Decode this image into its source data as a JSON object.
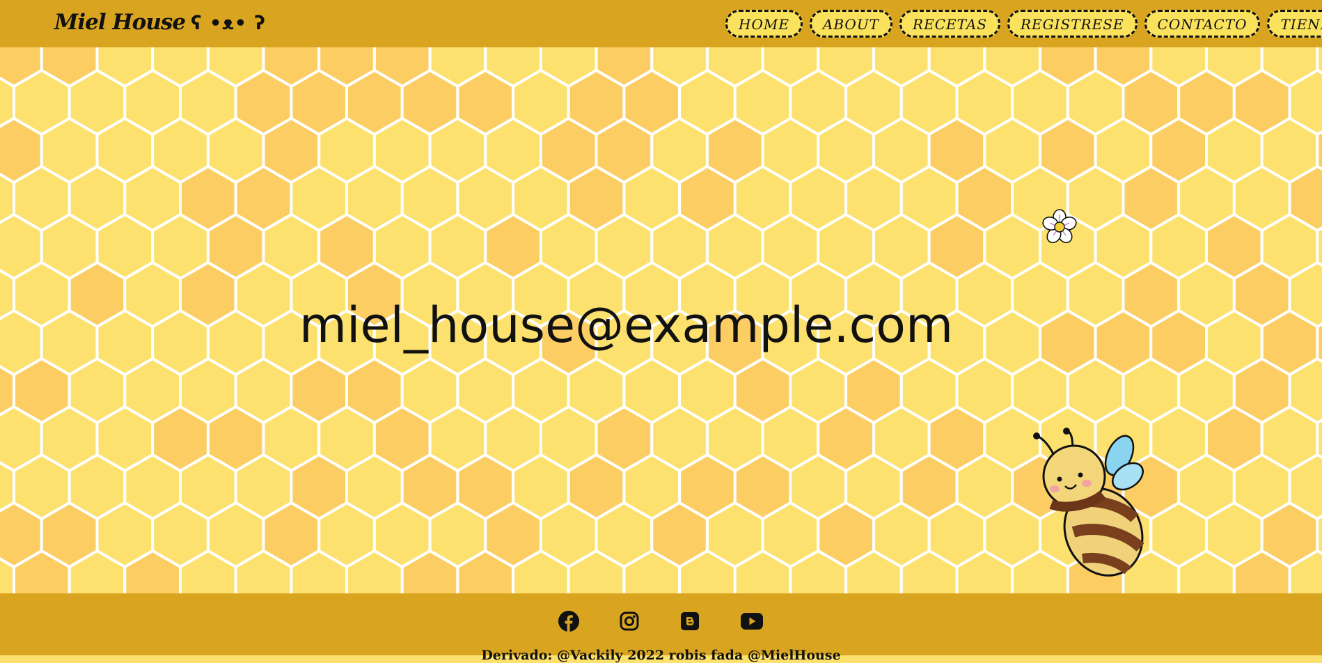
{
  "header": {
    "brand": "Miel House",
    "brand_face": "ʕ •ᴥ• ʔ",
    "nav": [
      "HOME",
      "ABOUT",
      "RECETAS",
      "REGISTRESE",
      "CONTACTO",
      "TIENDA"
    ]
  },
  "hero": {
    "email": "miel_house@example.com",
    "decor_icons": [
      "flower-icon",
      "bee-icon"
    ]
  },
  "footer": {
    "social_icons": [
      "facebook-icon",
      "instagram-icon",
      "blogger-icon",
      "youtube-icon"
    ],
    "credit": "Derivado: @Vackily 2022 robis fada @MielHouse"
  },
  "colors": {
    "bar": "#d9a521",
    "honey_light": "#fde16e",
    "honey_dark": "#fccd63",
    "text": "#111111"
  }
}
